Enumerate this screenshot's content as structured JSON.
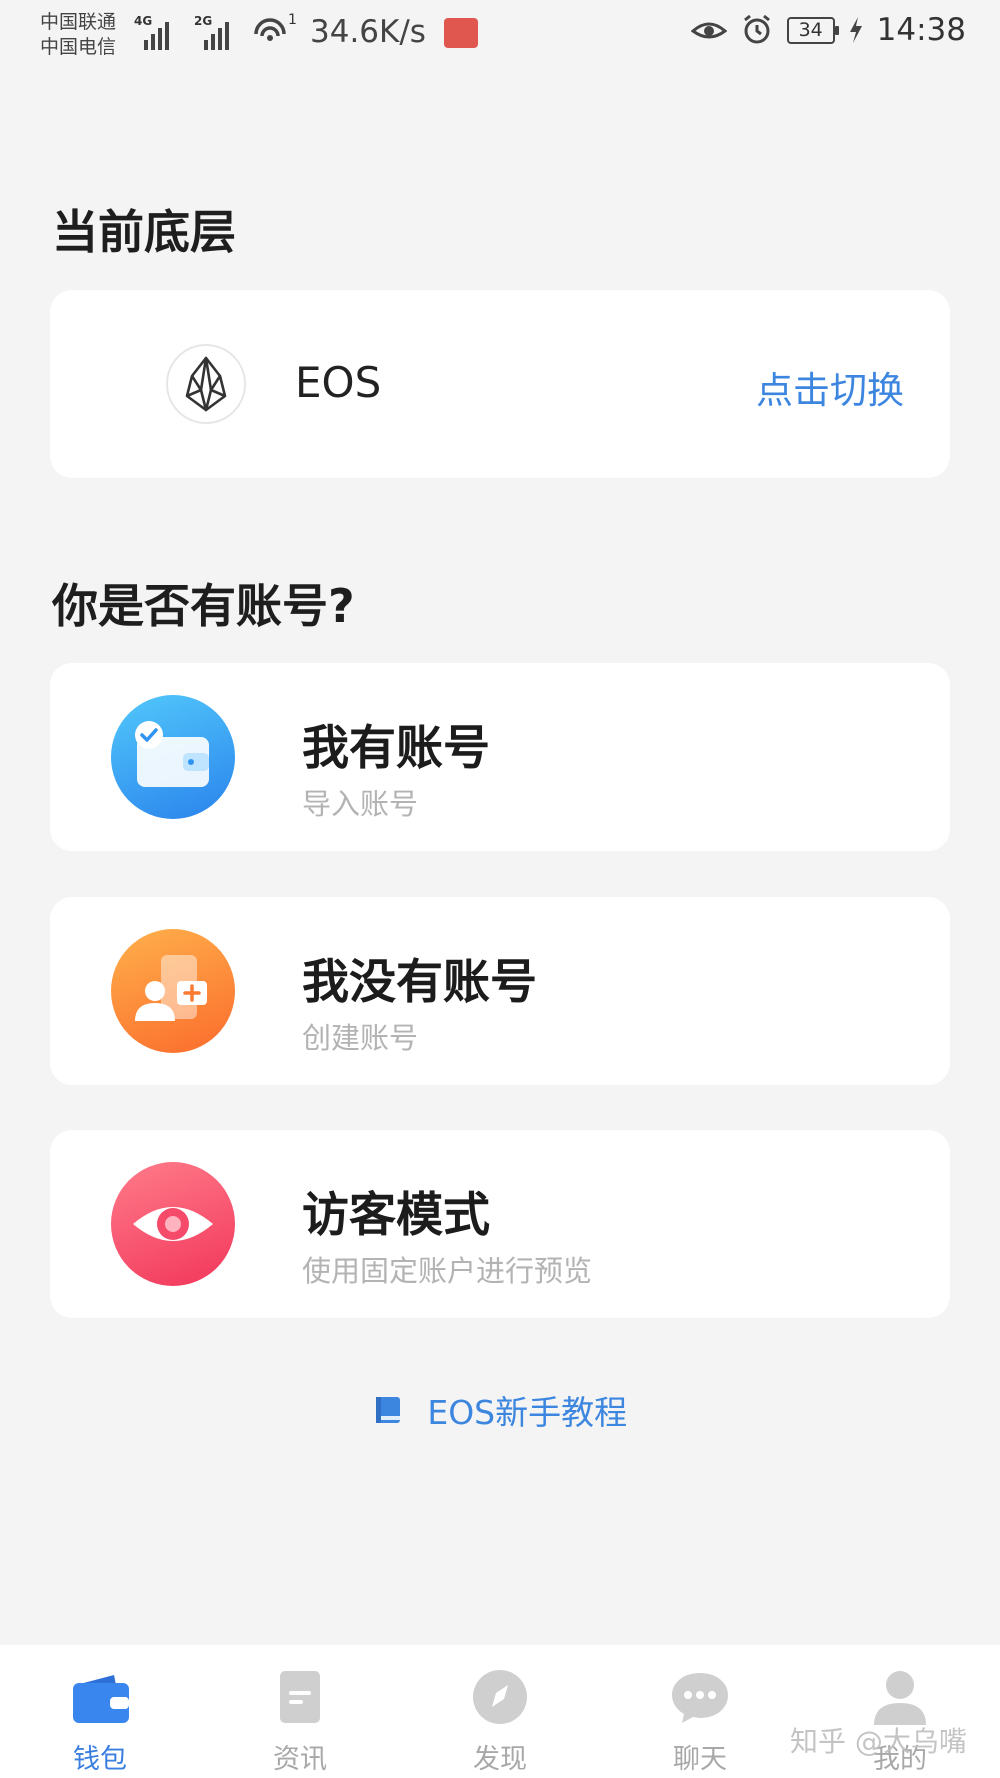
{
  "status_bar": {
    "carrier_1": "中国联通",
    "carrier_2": "中国电信",
    "network_1": "4G",
    "network_2": "2G",
    "hotspot_count": "1",
    "speed": "34.6K/s",
    "battery": "34",
    "time": "14:38",
    "icons": [
      "signal-icon",
      "hotspot-icon",
      "app-badge-icon",
      "eye-comfort-icon",
      "alarm-icon",
      "battery-icon",
      "charging-icon"
    ]
  },
  "current_chain": {
    "title": "当前底层",
    "name": "EOS",
    "switch_label": "点击切换",
    "icon": "eos-logo-icon"
  },
  "account_question": "你是否有账号?",
  "options": [
    {
      "title": "我有账号",
      "subtitle": "导入账号",
      "icon": "wallet-check-icon",
      "color": "#2f94f0"
    },
    {
      "title": "我没有账号",
      "subtitle": "创建账号",
      "icon": "create-account-icon",
      "color": "#fb8a3a"
    },
    {
      "title": "访客模式",
      "subtitle": "使用固定账户进行预览",
      "icon": "eye-icon",
      "color": "#f64a6a"
    }
  ],
  "tutorial_label": "EOS新手教程",
  "tabs": [
    {
      "label": "钱包",
      "icon": "wallet-icon",
      "active": true
    },
    {
      "label": "资讯",
      "icon": "news-icon",
      "active": false
    },
    {
      "label": "发现",
      "icon": "compass-icon",
      "active": false
    },
    {
      "label": "聊天",
      "icon": "chat-icon",
      "active": false
    },
    {
      "label": "我的",
      "icon": "profile-icon",
      "active": false
    }
  ],
  "watermark": "知乎 @大乌嘴",
  "colors": {
    "accent": "#3d86e0",
    "background": "#f4f4f5",
    "card": "#ffffff",
    "subtitle": "#b3b3b3"
  }
}
